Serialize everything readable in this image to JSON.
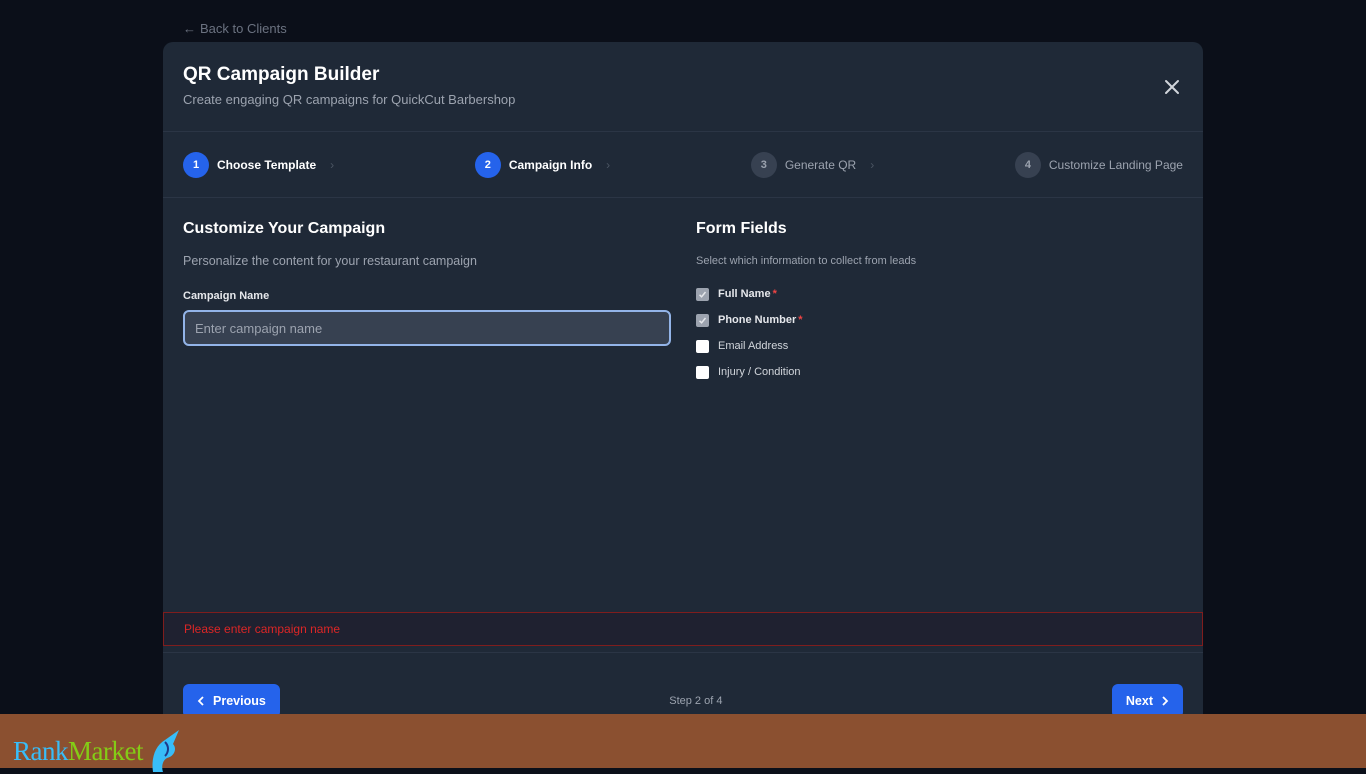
{
  "back_link": {
    "label": "Back to Clients"
  },
  "modal": {
    "title": "QR Campaign Builder",
    "subtitle": "Create engaging QR campaigns for QuickCut Barbershop"
  },
  "steps": [
    {
      "number": "1",
      "label": "Choose Template",
      "state": "active"
    },
    {
      "number": "2",
      "label": "Campaign Info",
      "state": "active"
    },
    {
      "number": "3",
      "label": "Generate QR",
      "state": "inactive"
    },
    {
      "number": "4",
      "label": "Customize Landing Page",
      "state": "inactive"
    }
  ],
  "left": {
    "title": "Customize Your Campaign",
    "description": "Personalize the content for your restaurant campaign",
    "campaign_name_label": "Campaign Name",
    "campaign_name_value": "",
    "campaign_name_placeholder": "Enter campaign name"
  },
  "right": {
    "title": "Form Fields",
    "description": "Select which information to collect from leads",
    "fields": [
      {
        "label": "Full Name",
        "checked": true,
        "required": true
      },
      {
        "label": "Phone Number",
        "checked": true,
        "required": true
      },
      {
        "label": "Email Address",
        "checked": false,
        "required": false
      },
      {
        "label": "Injury / Condition",
        "checked": false,
        "required": false
      }
    ],
    "required_mark": "*"
  },
  "error_message": "Please enter campaign name",
  "footer": {
    "previous_label": "Previous",
    "step_counter": "Step 2 of 4",
    "next_label": "Next"
  },
  "brand": {
    "part1": "Rank",
    "part2": "Market"
  },
  "colors": {
    "accent": "#2563eb",
    "error": "#dc2626",
    "modal_bg": "#1f2937",
    "page_bg": "#0b0f19",
    "footer_band": "#8b5030"
  }
}
